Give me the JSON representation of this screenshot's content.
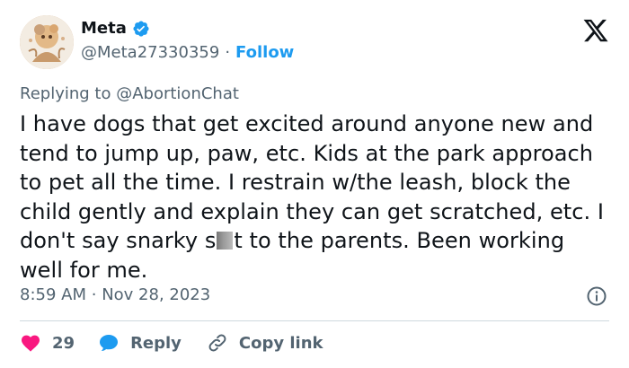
{
  "author": {
    "name": "Meta",
    "handle": "@Meta27330359",
    "separator": "·",
    "follow_label": "Follow",
    "verified_color": "#1d9bf0"
  },
  "reply_context": {
    "prefix": "Replying to",
    "mention": "@AbortionChat"
  },
  "tweet": {
    "text_part1": "I have dogs that get excited around anyone new and tend to jump up, paw, etc. Kids at the park approach to pet all the time. I restrain w/the leash, block the child gently and explain they can get scratched, etc. I don't say snarky s",
    "text_part2": "t to the parents. Been working well for me.",
    "time": "8:59 AM",
    "date_separator": "·",
    "date": "Nov 28, 2023"
  },
  "actions": {
    "like_count": "29",
    "reply_label": "Reply",
    "copy_label": "Copy link"
  },
  "icons": {
    "logo": "x-logo-icon",
    "verified": "verified-badge-icon",
    "info": "info-icon",
    "like": "heart-icon",
    "reply": "speech-bubble-icon",
    "copy": "link-icon"
  },
  "colors": {
    "accent": "#1d9bf0",
    "like": "#f91880",
    "text": "#0f1419",
    "muted": "#536471"
  }
}
